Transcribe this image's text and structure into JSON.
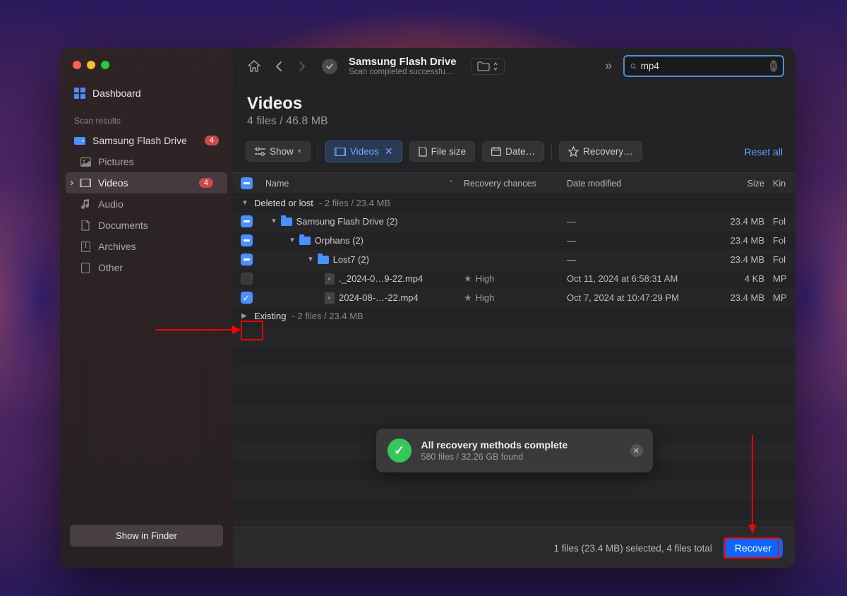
{
  "sidebar": {
    "dashboard_label": "Dashboard",
    "section_label": "Scan results",
    "items": [
      {
        "label": "Samsung Flash Drive",
        "badge": "4",
        "icon": "drive"
      },
      {
        "label": "Pictures",
        "icon": "picture"
      },
      {
        "label": "Videos",
        "badge": "4",
        "icon": "video",
        "active": true
      },
      {
        "label": "Audio",
        "icon": "audio"
      },
      {
        "label": "Documents",
        "icon": "document"
      },
      {
        "label": "Archives",
        "icon": "archive"
      },
      {
        "label": "Other",
        "icon": "other"
      }
    ],
    "footer_button": "Show in Finder"
  },
  "toolbar": {
    "title": "Samsung Flash Drive",
    "subtitle": "Scan completed successfu…",
    "search_value": "mp4"
  },
  "heading": {
    "title": "Videos",
    "subtitle": "4 files / 46.8 MB"
  },
  "filters": {
    "show": "Show",
    "videos": "Videos",
    "filesize": "File size",
    "date": "Date…",
    "recovery": "Recovery…",
    "reset": "Reset all"
  },
  "columns": {
    "name": "Name",
    "chances": "Recovery chances",
    "date": "Date modified",
    "size": "Size",
    "kind": "Kin"
  },
  "groups": [
    {
      "label": "Deleted or lost",
      "stats": "2 files / 23.4 MB",
      "expanded": true
    },
    {
      "label": "Existing",
      "stats": "2 files / 23.4 MB",
      "expanded": false
    }
  ],
  "rows": [
    {
      "check": "mixed",
      "indent": 1,
      "type": "folder",
      "name": "Samsung Flash Drive (2)",
      "chances": "",
      "date": "—",
      "size": "23.4 MB",
      "kind": "Fol"
    },
    {
      "check": "mixed",
      "indent": 2,
      "type": "folder",
      "name": "Orphans (2)",
      "chances": "",
      "date": "—",
      "size": "23.4 MB",
      "kind": "Fol"
    },
    {
      "check": "mixed",
      "indent": 3,
      "type": "folder",
      "name": "Lost7 (2)",
      "chances": "",
      "date": "—",
      "size": "23.4 MB",
      "kind": "Fol"
    },
    {
      "check": "empty",
      "indent": 4,
      "type": "file",
      "name": "._2024-0…9-22.mp4",
      "chances": "High",
      "date": "Oct 11, 2024 at 6:58:31 AM",
      "size": "4 KB",
      "kind": "MP"
    },
    {
      "check": "checked",
      "indent": 4,
      "type": "file",
      "name": "2024-08-…-22.mp4",
      "chances": "High",
      "date": "Oct 7, 2024 at 10:47:29 PM",
      "size": "23.4 MB",
      "kind": "MP"
    }
  ],
  "notification": {
    "title": "All recovery methods complete",
    "subtitle": "580 files / 32.26 GB found"
  },
  "footer": {
    "status": "1 files (23.4 MB) selected, 4 files total",
    "recover": "Recover"
  }
}
